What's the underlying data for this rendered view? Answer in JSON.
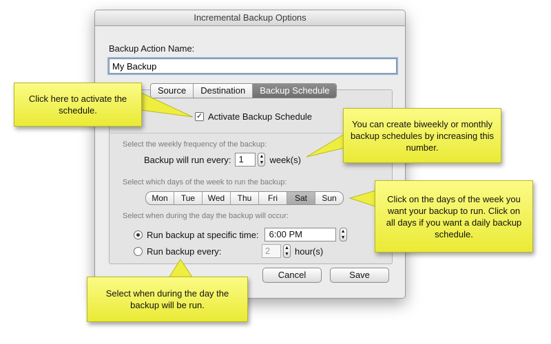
{
  "window": {
    "title": "Incremental Backup Options"
  },
  "name_section": {
    "label": "Backup Action Name:",
    "value": "My Backup"
  },
  "tabs": [
    {
      "label": "Source",
      "active": false
    },
    {
      "label": "Destination",
      "active": false
    },
    {
      "label": "Backup Schedule",
      "active": true
    }
  ],
  "schedule": {
    "activate_label": "Activate Backup Schedule",
    "activate_checked": true,
    "frequency_hint": "Select the weekly frequency of the backup:",
    "frequency_prefix": "Backup will run every:",
    "frequency_value": "1",
    "frequency_unit": "week(s)",
    "days_hint": "Select which days of the week to run the backup:",
    "days": [
      {
        "label": "Mon",
        "selected": false
      },
      {
        "label": "Tue",
        "selected": false
      },
      {
        "label": "Wed",
        "selected": false
      },
      {
        "label": "Thu",
        "selected": false
      },
      {
        "label": "Fri",
        "selected": false
      },
      {
        "label": "Sat",
        "selected": true
      },
      {
        "label": "Sun",
        "selected": false
      }
    ],
    "time_hint": "Select when during the day the backup will occur:",
    "specific_time_label": "Run backup at specific time:",
    "specific_time_value": "6:00 PM",
    "every_label": "Run backup every:",
    "every_value": "2",
    "every_unit": "hour(s)"
  },
  "buttons": {
    "cancel": "Cancel",
    "save": "Save"
  },
  "callouts": {
    "activate": "Click here to activate the schedule.",
    "frequency": "You can create biweekly or monthly backup schedules by increasing this number.",
    "days": "Click on the days of the week you want your backup to run. Click on all days if you want a daily backup schedule.",
    "time": "Select when during the day the backup will be run."
  },
  "colors": {
    "callout_yellow": "#f3f35c",
    "focus_ring": "#8fb3e0",
    "active_tab": "#7a7a7a"
  }
}
